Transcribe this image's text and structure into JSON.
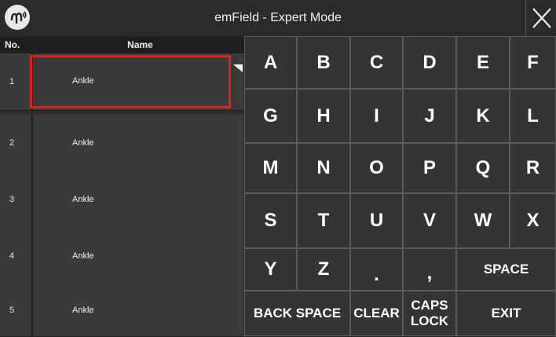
{
  "header": {
    "title": "emField - Expert Mode",
    "logo_glyph": "ᔑ",
    "close_icon": "close-icon"
  },
  "table": {
    "columns": [
      "No.",
      "Name"
    ],
    "rows": [
      {
        "no": "1",
        "name": "Ankle"
      },
      {
        "no": "2",
        "name": "Ankle"
      },
      {
        "no": "3",
        "name": "Ankle"
      },
      {
        "no": "4",
        "name": "Ankle"
      },
      {
        "no": "5",
        "name": "Ankle"
      }
    ]
  },
  "keyboard": {
    "row1": [
      "A",
      "B",
      "C",
      "D",
      "E",
      "F"
    ],
    "row2": [
      "G",
      "H",
      "I",
      "J",
      "K",
      "L"
    ],
    "row3": [
      "M",
      "N",
      "O",
      "P",
      "Q",
      "R"
    ],
    "row4": [
      "S",
      "T",
      "U",
      "V",
      "W",
      "X"
    ],
    "row5_keys": [
      "Y",
      "Z",
      ".",
      ","
    ],
    "space": "SPACE",
    "backspace": "BACK SPACE",
    "clear": "CLEAR",
    "caps_line1": "CAPS",
    "caps_line2": "LOCK",
    "exit": "EXIT"
  },
  "colors": {
    "background": "#2e2e2e",
    "selection_highlight": "#e02020",
    "key_text": "#ffffff"
  }
}
